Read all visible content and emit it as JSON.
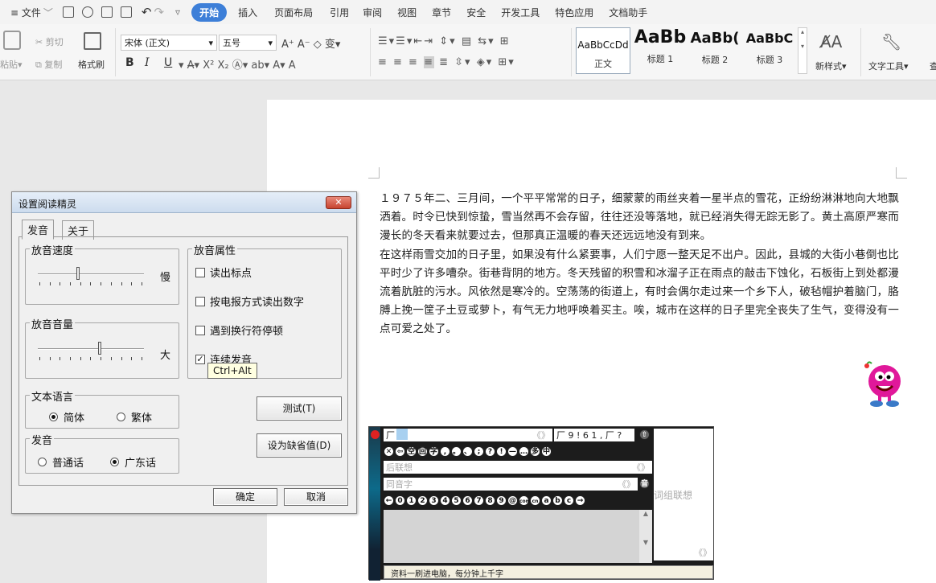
{
  "menubar": {
    "items": [
      "≡ 文件",
      "开始",
      "插入",
      "页面布局",
      "引用",
      "审阅",
      "视图",
      "章节",
      "安全",
      "开发工具",
      "特色应用",
      "文档助手"
    ],
    "active": "开始"
  },
  "ribbon": {
    "paste": "粘贴",
    "cut": "剪切",
    "copy": "复制",
    "format_painter": "格式刷",
    "font_name": "宋体 (正文)",
    "font_size": "五号",
    "bold": "B",
    "italic": "I",
    "underline": "U",
    "styles": [
      {
        "preview": "AaBbCcDd",
        "label": "正文"
      },
      {
        "preview": "AaBb",
        "label": "标题 1"
      },
      {
        "preview": "AaBb(",
        "label": "标题 2"
      },
      {
        "preview": "AaBbC",
        "label": "标题 3"
      }
    ],
    "new_style": "新样式",
    "text_tools": "文字工具",
    "cut_edge": "查"
  },
  "document": {
    "paragraphs": [
      "１９７５年二、三月间，一个平平常常的日子，细蒙蒙的雨丝夹着一星半点的雪花，正纷纷淋淋地向大地飘洒着。时令已快到惊蛰，雪当然再不会存留，往往还没等落地，就已经消失得无踪无影了。黄土高原严寒而漫长的冬天看来就要过去，但那真正温暖的春天还远远地没有到来。",
      "在这样雨雪交加的日子里，如果没有什么紧要事，人们宁愿一整天足不出户。因此，县城的大街小巷倒也比平时少了许多嘈杂。街巷背阴的地方。冬天残留的积雪和冰溜子正在雨点的敲击下蚀化，石板街上到处都漫流着肮脏的污水。风依然是寒冷的。空荡荡的街道上，有时会偶尔走过来一个乡下人，破毡帽护着脑门，胳膊上挽一筐子土豆或萝卜，有气无力地呼唤着买主。唉，城市在这样的日子里完全丧失了生气，变得没有一点可爱之处了。"
    ]
  },
  "dialog": {
    "title": "设置阅读精灵",
    "close": "✕",
    "tabs": [
      "发音",
      "关于"
    ],
    "speed": {
      "title": "放音速度",
      "suffix": "慢"
    },
    "volume": {
      "title": "放音音量",
      "suffix": "大"
    },
    "attributes": {
      "title": "放音属性",
      "options": [
        {
          "label": "读出标点",
          "checked": false
        },
        {
          "label": "按电报方式读出数字",
          "checked": false
        },
        {
          "label": "遇到换行符停顿",
          "checked": false
        },
        {
          "label": "连续发音",
          "checked": true
        }
      ]
    },
    "language": {
      "title": "文本语言",
      "options": [
        "简体",
        "繁体"
      ],
      "selected": "简体"
    },
    "pronunciation": {
      "title": "发音",
      "options": [
        "普通话",
        "广东话"
      ],
      "selected": "广东话"
    },
    "test_button": "测试(T)",
    "default_button": "设为缺省值(D)",
    "ok_button": "确定",
    "cancel_button": "取消",
    "tooltip": "Ctrl+Alt"
  },
  "ime": {
    "input": "厂",
    "candidates": "厂 9 ! 6 1 , 厂 ?",
    "hint_later": "后联想",
    "hint_homophone": "同音字",
    "phrase_assoc": "词组联想",
    "nav": "《》",
    "symbols": [
      "空",
      "回",
      "字",
      ",",
      "。",
      "、",
      ";",
      "?",
      "!",
      "—",
      "…",
      "多",
      "中"
    ],
    "digits": [
      "0",
      "1",
      "2",
      "3",
      "4",
      "5",
      "6",
      "7",
      "8",
      "9",
      "@",
      "com",
      "cn",
      "a",
      "b",
      "c"
    ],
    "status": "资料一刷进电脑，每分钟上千字"
  }
}
